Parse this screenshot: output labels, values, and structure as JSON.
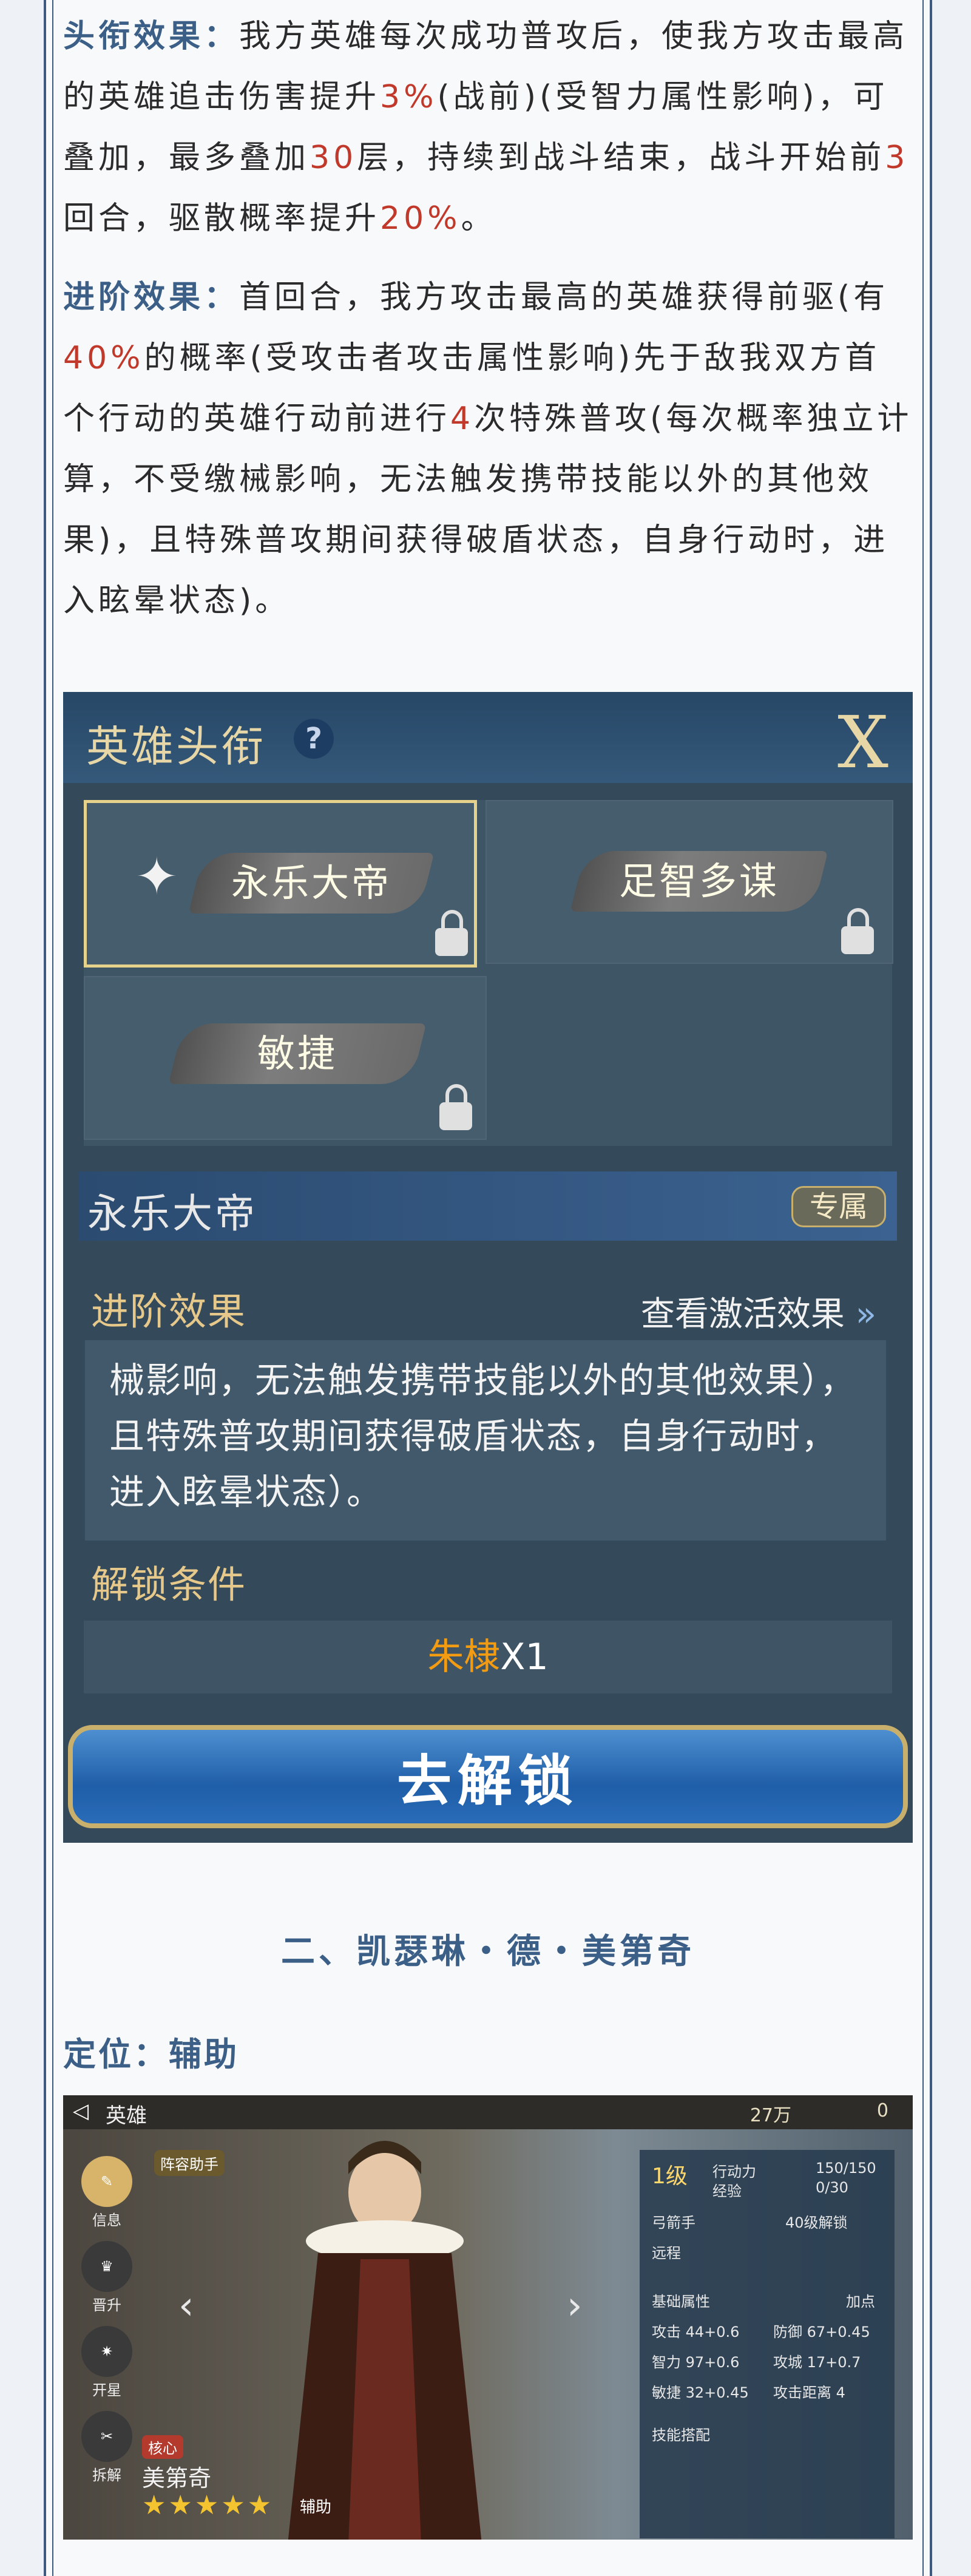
{
  "para1": {
    "label": "头衔效果：",
    "t1": "我方英雄每次成功普攻后，使我方攻击最高的英雄追击伤害提升",
    "v1": "3%",
    "t2": "(战前)(受智力属性影响)，可叠加，最多叠加",
    "v2": "30",
    "t3": "层，持续到战斗结束，战斗开始前",
    "v3": "3",
    "t4": "回合，驱散概率提升",
    "v4": "20%",
    "t5": "。"
  },
  "para2": {
    "label": "进阶效果：",
    "t1": "首回合，我方攻击最高的英雄获得前驱(有",
    "v1": "40%",
    "t2": "的概率(受攻击者攻击属性影响)先于敌我双方首个行动的英雄行动前进行",
    "v2": "4",
    "t3": "次特殊普攻(每次概率独立计算，不受缴械影响，无法触发携带技能以外的其他效果)，且特殊普攻期间获得破盾状态，自身行动时，进入眩晕状态)。"
  },
  "title_dialog": {
    "title": "英雄头衔",
    "help_icon": "?",
    "close_label": "X",
    "titles": [
      "永乐大帝",
      "足智多谋",
      "敏捷"
    ],
    "selected_name": "永乐大帝",
    "badge": "专属",
    "advanced_label": "进阶效果",
    "view_link": "查看激活效果",
    "desc": "械影响，无法触发携带技能以外的其他效果），且特殊普攻期间获得破盾状态，自身行动时，进入眩晕状态）。",
    "unlock_label": "解锁条件",
    "unlock_hero": "朱棣",
    "unlock_count": "X1",
    "unlock_button": "去解锁"
  },
  "section2": {
    "heading": "二、凯瑟琳・德・美第奇",
    "role": "定位：辅助"
  },
  "hero_screen": {
    "top_title": "英雄",
    "currency1": "27万",
    "currency2": "0",
    "side_items": [
      "信息",
      "晋升",
      "开星",
      "拆解"
    ],
    "assistant": "阵容助手",
    "core_tag": "核心",
    "hero_name": "美第奇",
    "stars": "★★★★★",
    "aux_tag": "辅助",
    "level": "1级",
    "action_label": "行动力",
    "action_value": "150/150",
    "exp_label": "经验",
    "exp_value": "0/30",
    "class_label": "弓箭手",
    "range_label": "远程",
    "unlock40": "40级解锁",
    "base_attr": "基础属性",
    "add_point": "加点",
    "attr1": "攻击 44+0.6",
    "attr2": "防御 67+0.45",
    "attr3": "智力 97+0.6",
    "attr4": "攻城 17+0.7",
    "attr5": "敏捷 32+0.45",
    "attr6": "攻击距离 4",
    "skill_label": "技能搭配"
  }
}
